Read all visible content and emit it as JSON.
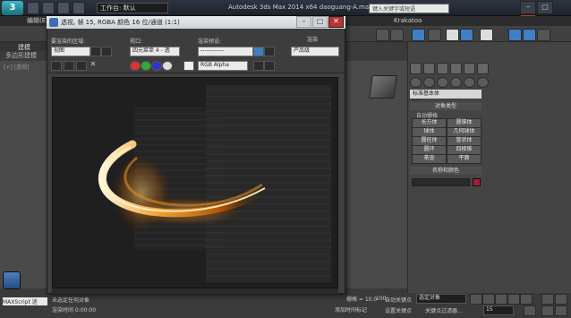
{
  "app": {
    "logo": "3",
    "workspace": "工作台: 默认",
    "title": "Autodesk 3ds Max 2014 x64    daoguang-A.max",
    "search_placeholder": "键入关键字或短语",
    "menu": [
      "编辑(E)",
      "Krakatoa"
    ],
    "window_controls": [
      "–",
      "▢",
      "✕"
    ]
  },
  "ribbon": {
    "tab": "建模",
    "sub": "多边形建模"
  },
  "viewport": {
    "label": "[+] [透视]"
  },
  "render_window": {
    "title": "透视, 帧 15, RGBA 颜色 16 位/通道 (1:1)",
    "area_label": "要渲染的区域:",
    "area_value": "视图",
    "viewport_label": "视口:",
    "viewport_value": "四元菜单 4 - 透",
    "preset_label": "渲染预设:",
    "preset_value": "------------",
    "render_button": "渲染",
    "render_mode": "产品级",
    "channel_value": "RGB Alpha"
  },
  "command_panel": {
    "category": "标准基本体",
    "object_type_header": "对象类型",
    "autogrid": "自动栅格",
    "primitives": [
      "长方体",
      "圆锥体",
      "球体",
      "几何球体",
      "圆柱体",
      "管状体",
      "圆环",
      "四棱锥",
      "茶壶",
      "平面"
    ],
    "name_color_header": "名称和颜色",
    "object_color": "#9e1f3a"
  },
  "status": {
    "maxscript": "MAXScript 迷",
    "line1": "未选定任何对象",
    "line2": "渲染时间 0:00:00",
    "grid": "栅格 = 10.0",
    "add_time_tag": "添加时间标记",
    "auto_key": "自动关键点",
    "selected_set": "选定对象",
    "set_key": "设置关键点",
    "key_filters": "关键点过滤器...",
    "frame": "15",
    "time_ruler_end": "100"
  }
}
